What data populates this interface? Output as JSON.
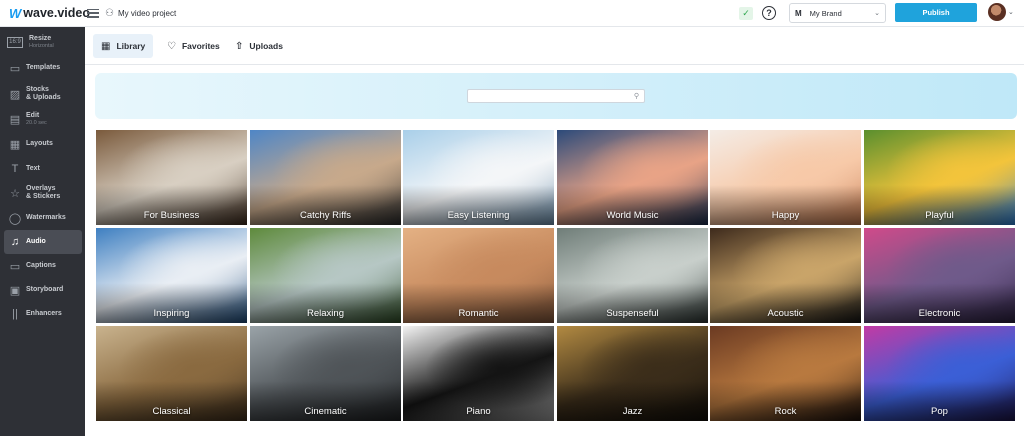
{
  "app": {
    "logo_mark": "W",
    "logo_text": "wave.video",
    "project_title": "My video project"
  },
  "header": {
    "check": "✓",
    "help": "?",
    "brand": {
      "initial": "M",
      "name": "My Brand"
    },
    "publish_label": "Publish"
  },
  "sidebar": {
    "items": [
      {
        "label": "Resize",
        "sub": "Horizontal",
        "icon": "resize-icon",
        "glyph": "16:9"
      },
      {
        "label": "Templates",
        "sub": "",
        "icon": "templates-icon",
        "glyph": "▭"
      },
      {
        "label": "Stocks\n& Uploads",
        "sub": "",
        "icon": "stocks-icon",
        "glyph": "▨"
      },
      {
        "label": "Edit",
        "sub": "20.0 sec",
        "icon": "edit-icon",
        "glyph": "▤"
      },
      {
        "label": "Layouts",
        "sub": "",
        "icon": "layouts-icon",
        "glyph": "▦"
      },
      {
        "label": "Text",
        "sub": "",
        "icon": "text-icon",
        "glyph": "T"
      },
      {
        "label": "Overlays\n& Stickers",
        "sub": "",
        "icon": "overlays-icon",
        "glyph": "☆"
      },
      {
        "label": "Watermarks",
        "sub": "",
        "icon": "watermarks-icon",
        "glyph": "◯"
      },
      {
        "label": "Audio",
        "sub": "",
        "icon": "audio-icon",
        "glyph": "♫"
      },
      {
        "label": "Captions",
        "sub": "",
        "icon": "captions-icon",
        "glyph": "▭"
      },
      {
        "label": "Storyboard",
        "sub": "",
        "icon": "storyboard-icon",
        "glyph": "▣"
      },
      {
        "label": "Enhancers",
        "sub": "",
        "icon": "enhancers-icon",
        "glyph": "||"
      }
    ],
    "active": "Audio"
  },
  "tabs": [
    {
      "label": "Library",
      "icon": "grid-icon",
      "glyph": "▦"
    },
    {
      "label": "Favorites",
      "icon": "heart-icon",
      "glyph": "♡"
    },
    {
      "label": "Uploads",
      "icon": "upload-icon",
      "glyph": "⇧"
    }
  ],
  "search": {
    "placeholder": "",
    "icon": "search-icon"
  },
  "genres": [
    {
      "label": "For Business",
      "colors": [
        "#7a5a3c",
        "#d8cfc2",
        "#3d2b1d"
      ]
    },
    {
      "label": "Catchy Riffs",
      "colors": [
        "#4f86c6",
        "#c7a98b",
        "#2a2a2a"
      ]
    },
    {
      "label": "Easy Listening",
      "colors": [
        "#a9cfe9",
        "#f4f6f8",
        "#6c8eaa"
      ]
    },
    {
      "label": "World Music",
      "colors": [
        "#2c4a7a",
        "#e8a386",
        "#1a2d4f"
      ]
    },
    {
      "label": "Happy",
      "colors": [
        "#f4ece6",
        "#f7c9a8",
        "#c0764c"
      ]
    },
    {
      "label": "Playful",
      "colors": [
        "#5a8f2e",
        "#f3c43b",
        "#2c7fd6"
      ]
    },
    {
      "label": "Inspiring",
      "colors": [
        "#3e7fc1",
        "#e9eef4",
        "#1e4a78"
      ]
    },
    {
      "label": "Relaxing",
      "colors": [
        "#5e8a3c",
        "#b6c7c4",
        "#2d4a25"
      ]
    },
    {
      "label": "Romantic",
      "colors": [
        "#e4b184",
        "#c78a5e",
        "#7d5338"
      ]
    },
    {
      "label": "Suspenseful",
      "colors": [
        "#6f7d78",
        "#c8cfcb",
        "#2b3431"
      ]
    },
    {
      "label": "Acoustic",
      "colors": [
        "#3d2a1c",
        "#c9a469",
        "#121212"
      ]
    },
    {
      "label": "Electronic",
      "colors": [
        "#d04a8a",
        "#6f5a8a",
        "#2b2040"
      ]
    },
    {
      "label": "Classical",
      "colors": [
        "#c9b38e",
        "#8a6a40",
        "#3d2d1b"
      ]
    },
    {
      "label": "Cinematic",
      "colors": [
        "#9aa3a8",
        "#4f5458",
        "#1e2022"
      ]
    },
    {
      "label": "Piano",
      "colors": [
        "#f4f4f4",
        "#141414",
        "#9a9a9a"
      ]
    },
    {
      "label": "Jazz",
      "colors": [
        "#b28a42",
        "#3b2d1a",
        "#120e08"
      ]
    },
    {
      "label": "Rock",
      "colors": [
        "#6b3a22",
        "#b8793f",
        "#1a0f0a"
      ]
    },
    {
      "label": "Pop",
      "colors": [
        "#c23aa4",
        "#3b5fd6",
        "#1b1346"
      ]
    }
  ]
}
